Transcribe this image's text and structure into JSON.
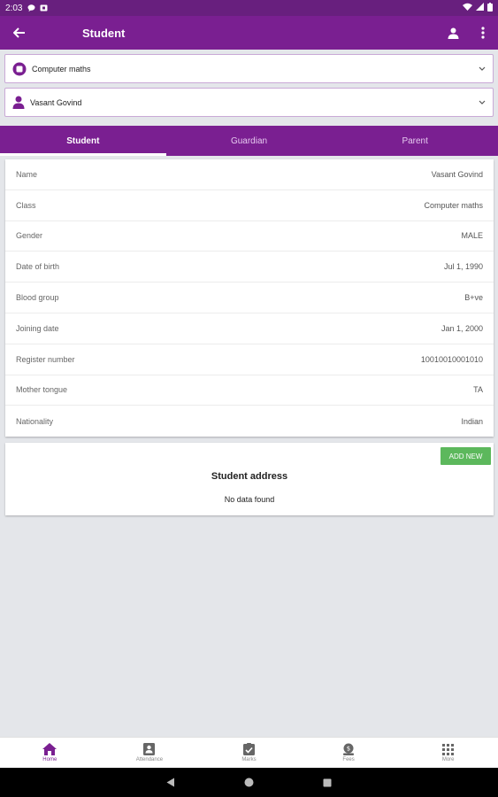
{
  "statusbar": {
    "time": "2:03"
  },
  "appbar": {
    "title": "Student"
  },
  "selectors": {
    "class": "Computer maths",
    "student": "Vasant  Govind"
  },
  "tabs": [
    {
      "label": "Student"
    },
    {
      "label": "Guardian"
    },
    {
      "label": "Parent"
    }
  ],
  "student_info": [
    {
      "label": "Name",
      "value": "Vasant  Govind"
    },
    {
      "label": "Class",
      "value": "Computer maths"
    },
    {
      "label": "Gender",
      "value": "MALE"
    },
    {
      "label": "Date of birth",
      "value": "Jul 1, 1990"
    },
    {
      "label": "Blood group",
      "value": "B+ve"
    },
    {
      "label": "Joining date",
      "value": "Jan 1, 2000"
    },
    {
      "label": "Register number",
      "value": "10010010001010"
    },
    {
      "label": "Mother tongue",
      "value": "TA"
    },
    {
      "label": "Nationality",
      "value": "Indian"
    }
  ],
  "address": {
    "add_button": "ADD NEW",
    "title": "Student address",
    "empty": "No data found"
  },
  "bottom_nav": [
    {
      "label": "Home",
      "icon": "home-icon"
    },
    {
      "label": "Attendance",
      "icon": "attendance-icon"
    },
    {
      "label": "Marks",
      "icon": "marks-icon"
    },
    {
      "label": "Fees",
      "icon": "fees-icon"
    },
    {
      "label": "More",
      "icon": "more-grid-icon"
    }
  ],
  "colors": {
    "primary": "#7a1f91",
    "status": "#681f7e",
    "accent_green": "#5cb85c"
  }
}
